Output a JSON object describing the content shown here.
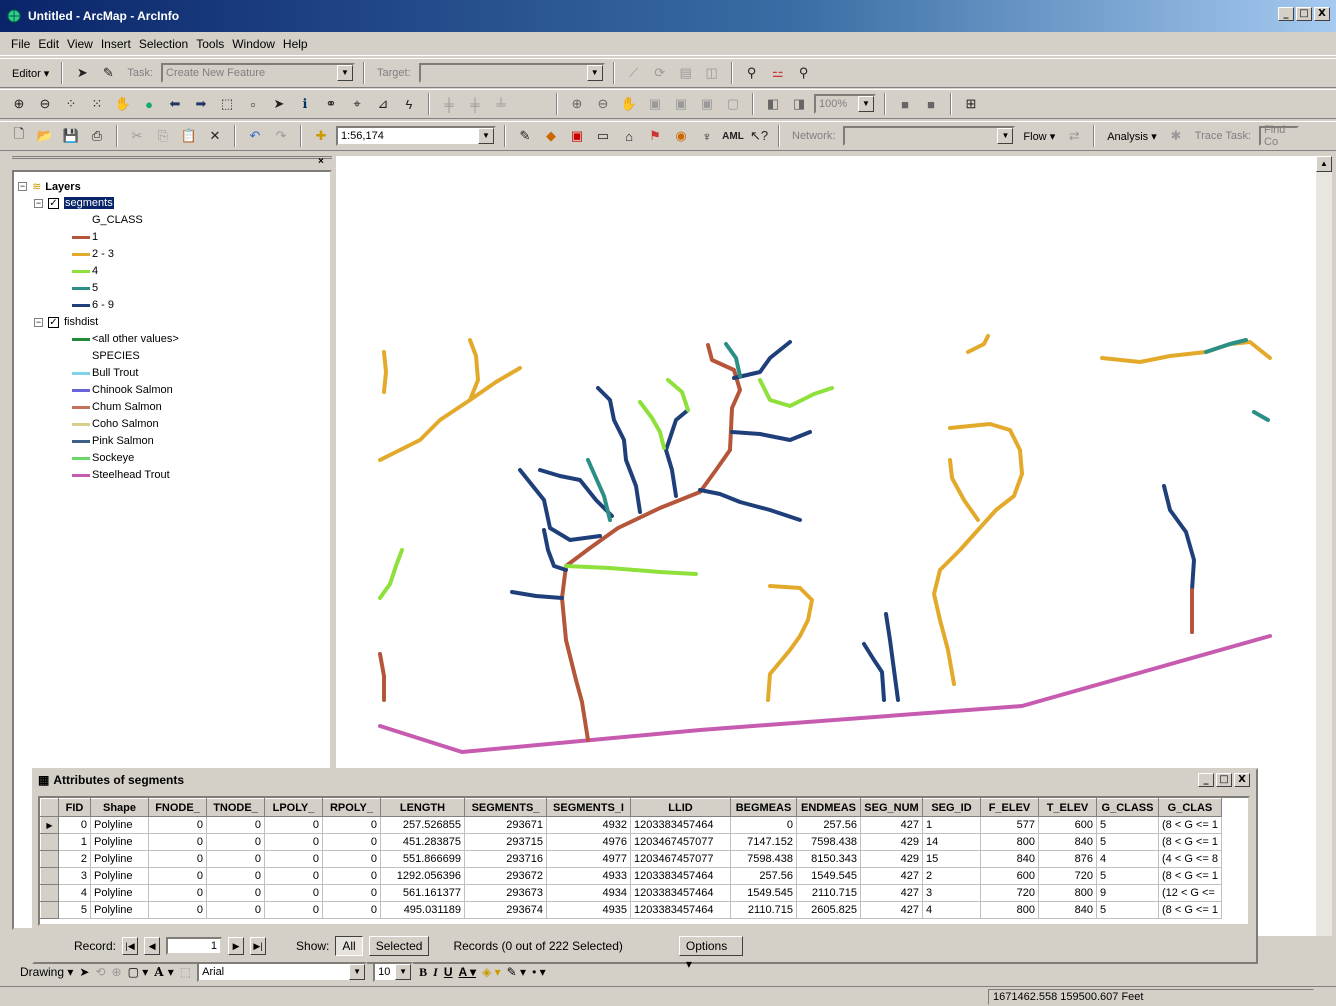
{
  "window": {
    "title": "Untitled - ArcMap - ArcInfo",
    "controls": [
      "_",
      "□",
      "X"
    ]
  },
  "menu": [
    "File",
    "Edit",
    "View",
    "Insert",
    "Selection",
    "Tools",
    "Window",
    "Help"
  ],
  "editor_toolbar": {
    "editor_label": "Editor",
    "task_label": "Task:",
    "task_value": "Create New Feature",
    "target_label": "Target:",
    "target_value": ""
  },
  "standard_toolbar": {
    "scale": "1:56,174",
    "network_label": "Network:",
    "network_value": "",
    "flow_label": "Flow",
    "analysis_label": "Analysis",
    "trace_task_label": "Trace Task:",
    "find_placeholder": "Find Co"
  },
  "tools_toolbar": {
    "zoom_percent": "100%"
  },
  "toc": {
    "root": "Layers",
    "layers": [
      {
        "name": "segments",
        "field": "G_CLASS",
        "classes": [
          {
            "label": "1",
            "color": "#b5553a"
          },
          {
            "label": "2 - 3",
            "color": "#e3a92a"
          },
          {
            "label": "4",
            "color": "#8ee03a"
          },
          {
            "label": "5",
            "color": "#2b8f86"
          },
          {
            "label": "6 - 9",
            "color": "#1f3f7a"
          }
        ]
      },
      {
        "name": "fishdist",
        "other_values": {
          "label": "<all other values>",
          "color": "#1e8a3a"
        },
        "field": "SPECIES",
        "classes": [
          {
            "label": "Bull Trout",
            "color": "#7fd3e8"
          },
          {
            "label": "Chinook Salmon",
            "color": "#6a62d8"
          },
          {
            "label": "Chum Salmon",
            "color": "#c4725a"
          },
          {
            "label": "Coho Salmon",
            "color": "#d8d08a"
          },
          {
            "label": "Pink Salmon",
            "color": "#3b5f86"
          },
          {
            "label": "Sockeye",
            "color": "#6bd86b"
          },
          {
            "label": "Steelhead Trout",
            "color": "#c75bb0"
          }
        ]
      }
    ]
  },
  "attributes": {
    "title": "Attributes of segments",
    "columns": [
      "FID",
      "Shape",
      "FNODE_",
      "TNODE_",
      "LPOLY_",
      "RPOLY_",
      "LENGTH",
      "SEGMENTS_",
      "SEGMENTS_I",
      "LLID",
      "BEGMEAS",
      "ENDMEAS",
      "SEG_NUM",
      "SEG_ID",
      "F_ELEV",
      "T_ELEV",
      "G_CLASS",
      "G_CLAS"
    ],
    "rows": [
      [
        "0",
        "Polyline",
        "0",
        "0",
        "0",
        "0",
        "257.526855",
        "293671",
        "4932",
        "1203383457464",
        "0",
        "257.56",
        "427",
        "1",
        "577",
        "600",
        "5",
        "(8 < G <= 1"
      ],
      [
        "1",
        "Polyline",
        "0",
        "0",
        "0",
        "0",
        "451.283875",
        "293715",
        "4976",
        "1203467457077",
        "7147.152",
        "7598.438",
        "429",
        "14",
        "800",
        "840",
        "5",
        "(8 < G <= 1"
      ],
      [
        "2",
        "Polyline",
        "0",
        "0",
        "0",
        "0",
        "551.866699",
        "293716",
        "4977",
        "1203467457077",
        "7598.438",
        "8150.343",
        "429",
        "15",
        "840",
        "876",
        "4",
        "(4 < G <= 8"
      ],
      [
        "3",
        "Polyline",
        "0",
        "0",
        "0",
        "0",
        "1292.056396",
        "293672",
        "4933",
        "1203383457464",
        "257.56",
        "1549.545",
        "427",
        "2",
        "600",
        "720",
        "5",
        "(8 < G <= 1"
      ],
      [
        "4",
        "Polyline",
        "0",
        "0",
        "0",
        "0",
        "561.161377",
        "293673",
        "4934",
        "1203383457464",
        "1549.545",
        "2110.715",
        "427",
        "3",
        "720",
        "800",
        "9",
        "(12 < G <="
      ],
      [
        "5",
        "Polyline",
        "0",
        "0",
        "0",
        "0",
        "495.031189",
        "293674",
        "4935",
        "1203383457464",
        "2110.715",
        "2605.825",
        "427",
        "4",
        "800",
        "840",
        "5",
        "(8 < G <= 1"
      ]
    ],
    "record_label": "Record:",
    "record_value": "1",
    "show_label": "Show:",
    "show_all": "All",
    "show_selected": "Selected",
    "records_status": "Records (0 out of 222 Selected)",
    "options_label": "Options"
  },
  "drawing_toolbar": {
    "drawing_label": "Drawing",
    "font_name": "Arial",
    "font_size": "10",
    "bold": "B",
    "italic": "I",
    "underline": "U"
  },
  "status": {
    "coordinates": "1671462.558  159500.607 Feet"
  }
}
